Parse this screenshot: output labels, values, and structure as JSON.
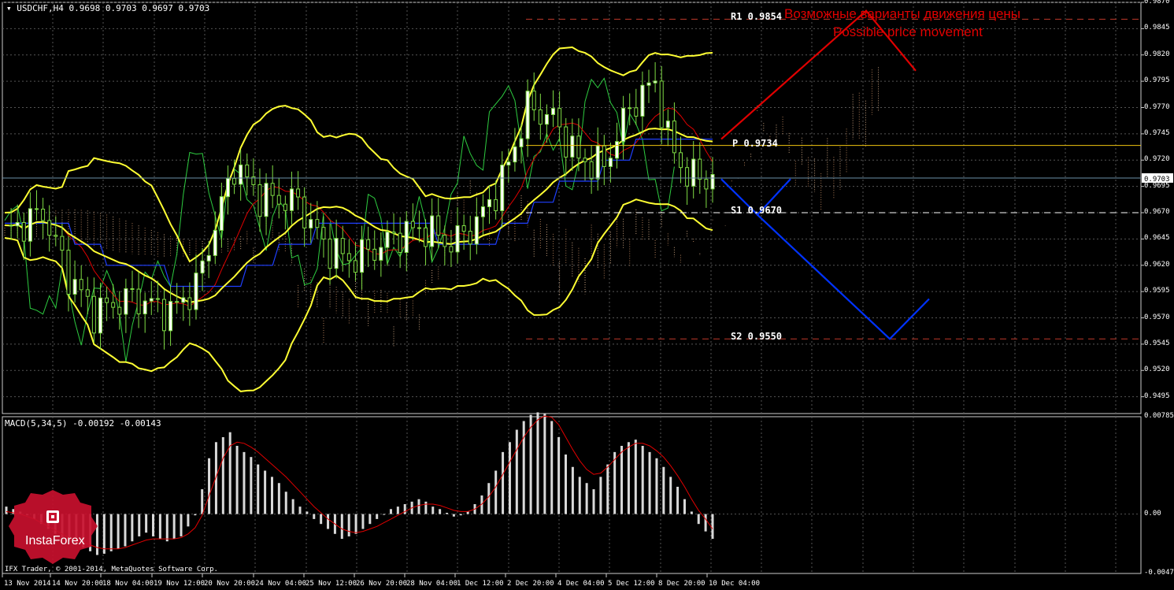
{
  "header": {
    "symbol_line": "USDCHF,H4  0.9698 0.9703 0.9697 0.9703",
    "indicator_line": "MACD(5,34,5) -0.00192 -0.00143"
  },
  "annotations": {
    "ru": "Возможные варианты движения цены",
    "en": "Possible price movement"
  },
  "copyright": "IFX Trader, © 2001-2014, MetaQuotes Software Corp.",
  "logo": {
    "text": "InstaForex"
  },
  "chart_data": [
    {
      "type": "line",
      "instrument": "USDCHF",
      "timeframe": "H4",
      "current_price": "0.9703",
      "ylim": [
        0.9479,
        0.987
      ],
      "y_ticks": [
        "0.9870",
        "0.9845",
        "0.9820",
        "0.9795",
        "0.9770",
        "0.9745",
        "0.9720",
        "0.9695",
        "0.9670",
        "0.9645",
        "0.9620",
        "0.9595",
        "0.9570",
        "0.9545",
        "0.9520",
        "0.9495"
      ],
      "x_ticks": [
        "13 Nov 2014",
        "14 Nov 20:00",
        "18 Nov 04:00",
        "19 Nov 12:00",
        "20 Nov 20:00",
        "24 Nov 04:00",
        "25 Nov 12:00",
        "26 Nov 20:00",
        "28 Nov 04:00",
        "1 Dec 12:00",
        "2 Dec 20:00",
        "4 Dec 04:00",
        "5 Dec 12:00",
        "8 Dec 20:00",
        "10 Dec 04:00"
      ],
      "levels": [
        {
          "name": "R1",
          "label": "R1 0.9854",
          "value": 0.9854,
          "style": "dashed",
          "color": "#c0392b"
        },
        {
          "name": "P",
          "label": "P 0.9734",
          "value": 0.9734,
          "style": "solid",
          "color": "#f1c40f"
        },
        {
          "name": "S1",
          "label": "S1 0.9670",
          "value": 0.967,
          "style": "dashed",
          "color": "#ffffff"
        },
        {
          "name": "S2",
          "label": "S2 0.9550",
          "value": 0.955,
          "style": "dashed",
          "color": "#c0392b"
        }
      ],
      "price_line": 0.9703,
      "scenarios": [
        {
          "name": "up",
          "color": "#e00000",
          "points": [
            [
              0,
              0.9738
            ],
            [
              1,
              0.986
            ],
            [
              2,
              0.9805
            ]
          ]
        },
        {
          "name": "down",
          "color": "#0033ff",
          "points": [
            [
              0,
              0.9702
            ],
            [
              1,
              0.9668
            ],
            [
              2,
              0.97
            ],
            [
              3,
              0.965
            ],
            [
              4,
              0.955
            ],
            [
              5,
              0.9588
            ]
          ]
        }
      ]
    },
    {
      "type": "bar",
      "name": "MACD(5,34,5)",
      "ylim": [
        -0.00479,
        0.00785
      ],
      "y_ticks": [
        "0.00785",
        "0.00",
        "-0.00479"
      ],
      "values": [
        0.0006,
        0.0004,
        0.0002,
        -0.0001,
        -0.0004,
        -0.0008,
        -0.0012,
        -0.0016,
        -0.002,
        -0.0022,
        -0.0025,
        -0.0027,
        -0.003,
        -0.0033,
        -0.0032,
        -0.003,
        -0.0028,
        -0.0026,
        -0.0022,
        -0.0018,
        -0.0015,
        -0.0018,
        -0.002,
        -0.0022,
        -0.002,
        -0.0018,
        -0.001,
        -0.0001,
        0.002,
        0.0045,
        0.0058,
        0.0062,
        0.0066,
        0.0055,
        0.005,
        0.0046,
        0.004,
        0.0035,
        0.003,
        0.0025,
        0.0018,
        0.0012,
        0.0006,
        0.0002,
        -0.0004,
        -0.0008,
        -0.0012,
        -0.0016,
        -0.002,
        -0.0018,
        -0.0016,
        -0.0012,
        -0.0008,
        -0.0004,
        0.0,
        0.0004,
        0.0006,
        0.0008,
        0.001,
        0.0012,
        0.001,
        0.0006,
        0.0004,
        0.0001,
        -0.0002,
        -0.0001,
        0.0002,
        0.0008,
        0.0015,
        0.0025,
        0.0035,
        0.005,
        0.0058,
        0.0068,
        0.0075,
        0.008,
        0.0082,
        0.0081,
        0.0075,
        0.0062,
        0.0048,
        0.0038,
        0.003,
        0.0025,
        0.002,
        0.003,
        0.004,
        0.005,
        0.0055,
        0.0058,
        0.006,
        0.0055,
        0.005,
        0.0045,
        0.0038,
        0.003,
        0.0022,
        0.0012,
        0.0002,
        -0.0008,
        -0.0014,
        -0.002
      ],
      "signal": [
        0.0002,
        0.0001,
        0.0,
        -0.0002,
        -0.0004,
        -0.0007,
        -0.001,
        -0.0013,
        -0.0016,
        -0.0019,
        -0.0021,
        -0.0023,
        -0.0025,
        -0.0027,
        -0.0028,
        -0.0028,
        -0.0028,
        -0.0027,
        -0.0025,
        -0.0023,
        -0.0021,
        -0.002,
        -0.002,
        -0.002,
        -0.002,
        -0.0019,
        -0.0016,
        -0.0011,
        -0.0001,
        0.0015,
        0.003,
        0.0045,
        0.0055,
        0.0058,
        0.0057,
        0.0054,
        0.005,
        0.0045,
        0.004,
        0.0035,
        0.003,
        0.0024,
        0.0018,
        0.0012,
        0.0006,
        0.0001,
        -0.0004,
        -0.0008,
        -0.0012,
        -0.0014,
        -0.0015,
        -0.0014,
        -0.0012,
        -0.001,
        -0.0007,
        -0.0004,
        -0.0001,
        0.0002,
        0.0005,
        0.0007,
        0.0008,
        0.0008,
        0.0007,
        0.0005,
        0.0003,
        0.0002,
        0.0002,
        0.0004,
        0.0008,
        0.0014,
        0.0022,
        0.0032,
        0.0042,
        0.0052,
        0.0062,
        0.007,
        0.0076,
        0.0079,
        0.0078,
        0.0072,
        0.0062,
        0.0052,
        0.0043,
        0.0036,
        0.0032,
        0.0033,
        0.0038,
        0.0044,
        0.005,
        0.0054,
        0.0057,
        0.0057,
        0.0055,
        0.0051,
        0.0046,
        0.0039,
        0.0031,
        0.0022,
        0.0012,
        0.0003,
        -0.0004,
        -0.0012
      ]
    }
  ]
}
